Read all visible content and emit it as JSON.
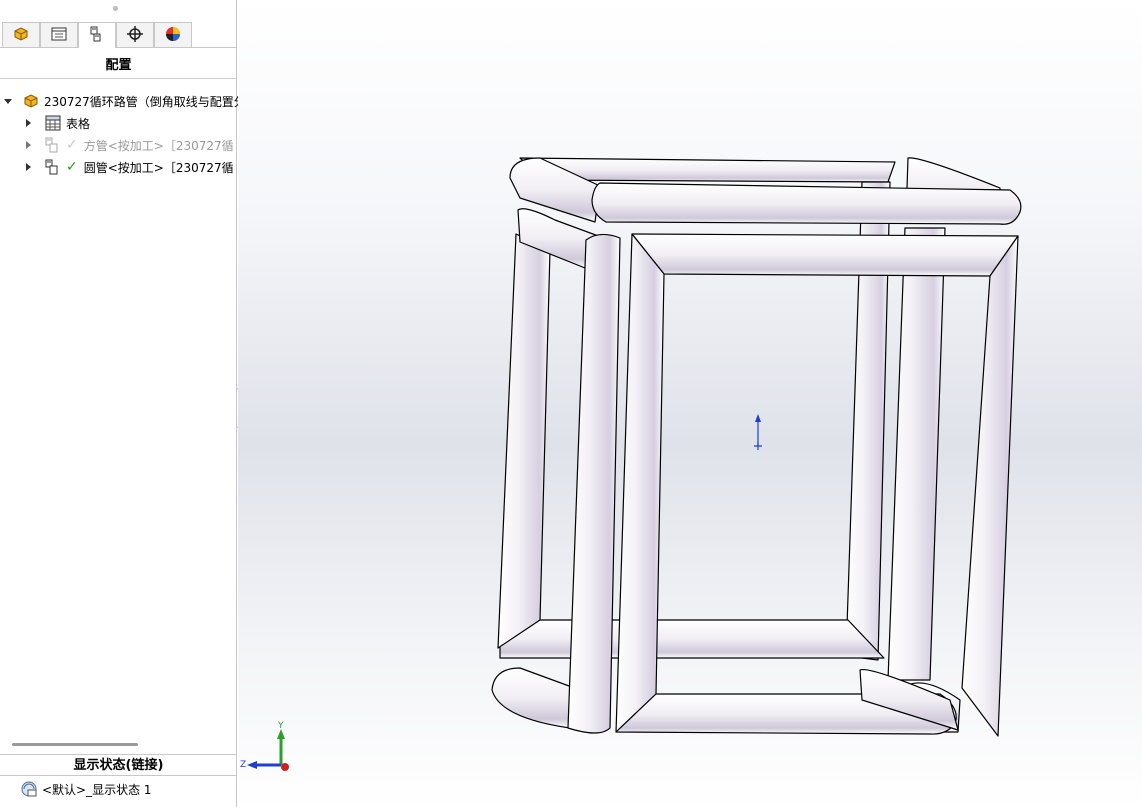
{
  "sidebar": {
    "tabs": [
      {
        "icon": "part-feature-icon"
      },
      {
        "icon": "property-manager-icon"
      },
      {
        "icon": "configuration-manager-icon",
        "active": true
      },
      {
        "icon": "dimxpert-icon"
      },
      {
        "icon": "display-manager-icon"
      }
    ],
    "panel_title": "配置",
    "tree": {
      "root_label": "230727循环路管（倒角取线与配置分",
      "table_label": "表格",
      "configs": [
        {
          "label": "方管<按加工>［230727循",
          "active": false
        },
        {
          "label": "圆管<按加工>［230727循",
          "active": true
        }
      ]
    },
    "display_state": {
      "header": "显示状态(链接)",
      "item_label": "<默认>_显示状态 1"
    }
  },
  "viewport": {
    "triad": {
      "x_label": "Z",
      "y_label": "Y"
    }
  },
  "colors": {
    "check_active": "#2f9a1f",
    "triad_y": "#2aa02a",
    "triad_z": "#1f3fd0",
    "triad_x": "#d02020",
    "tube_shade": "#dcd6e4"
  }
}
